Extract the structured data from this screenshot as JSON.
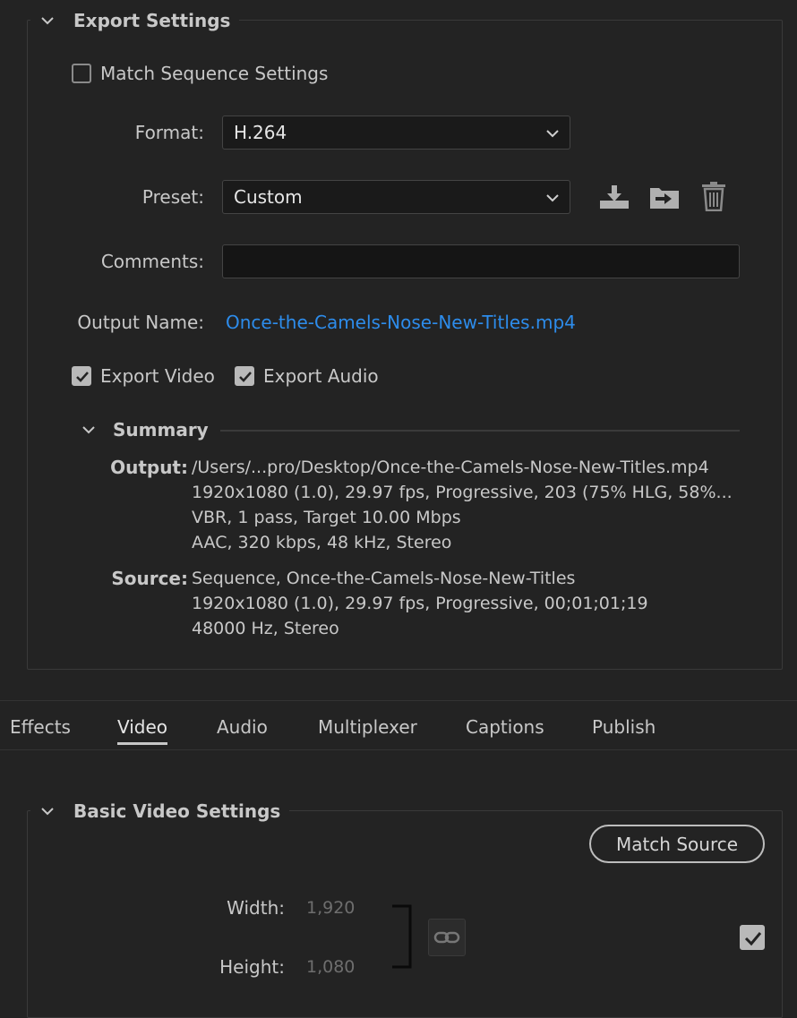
{
  "export_settings": {
    "title": "Export Settings",
    "match_sequence_label": "Match Sequence Settings",
    "match_sequence_checked": false,
    "format_label": "Format:",
    "format_value": "H.264",
    "preset_label": "Preset:",
    "preset_value": "Custom",
    "comments_label": "Comments:",
    "comments_value": "",
    "output_name_label": "Output Name:",
    "output_name_value": "Once-the-Camels-Nose-New-Titles.mp4",
    "export_video_label": "Export Video",
    "export_video_checked": true,
    "export_audio_label": "Export Audio",
    "export_audio_checked": true,
    "icons": {
      "save_preset": "save-preset-icon",
      "import_preset": "import-preset-icon",
      "delete_preset": "trash-icon"
    }
  },
  "summary": {
    "title": "Summary",
    "output_label": "Output:",
    "output_lines": [
      "/Users/...pro/Desktop/Once-the-Camels-Nose-New-Titles.mp4",
      "1920x1080 (1.0), 29.97 fps, Progressive, 203 (75% HLG, 58%...",
      "VBR, 1 pass, Target 10.00 Mbps",
      "AAC, 320 kbps, 48 kHz, Stereo"
    ],
    "source_label": "Source:",
    "source_lines": [
      "Sequence, Once-the-Camels-Nose-New-Titles",
      "1920x1080 (1.0), 29.97 fps, Progressive, 00;01;01;19",
      "48000 Hz, Stereo"
    ]
  },
  "tabs": [
    {
      "label": "Effects",
      "active": false
    },
    {
      "label": "Video",
      "active": true
    },
    {
      "label": "Audio",
      "active": false
    },
    {
      "label": "Multiplexer",
      "active": false
    },
    {
      "label": "Captions",
      "active": false
    },
    {
      "label": "Publish",
      "active": false
    }
  ],
  "basic_video": {
    "title": "Basic Video Settings",
    "match_source_label": "Match Source",
    "width_label": "Width:",
    "width_value": "1,920",
    "height_label": "Height:",
    "height_value": "1,080",
    "link_icon": "link-icon",
    "checkbox_checked": true
  },
  "colors": {
    "background": "#232323",
    "link": "#2d8ceb",
    "text": "#c8c8c8"
  }
}
